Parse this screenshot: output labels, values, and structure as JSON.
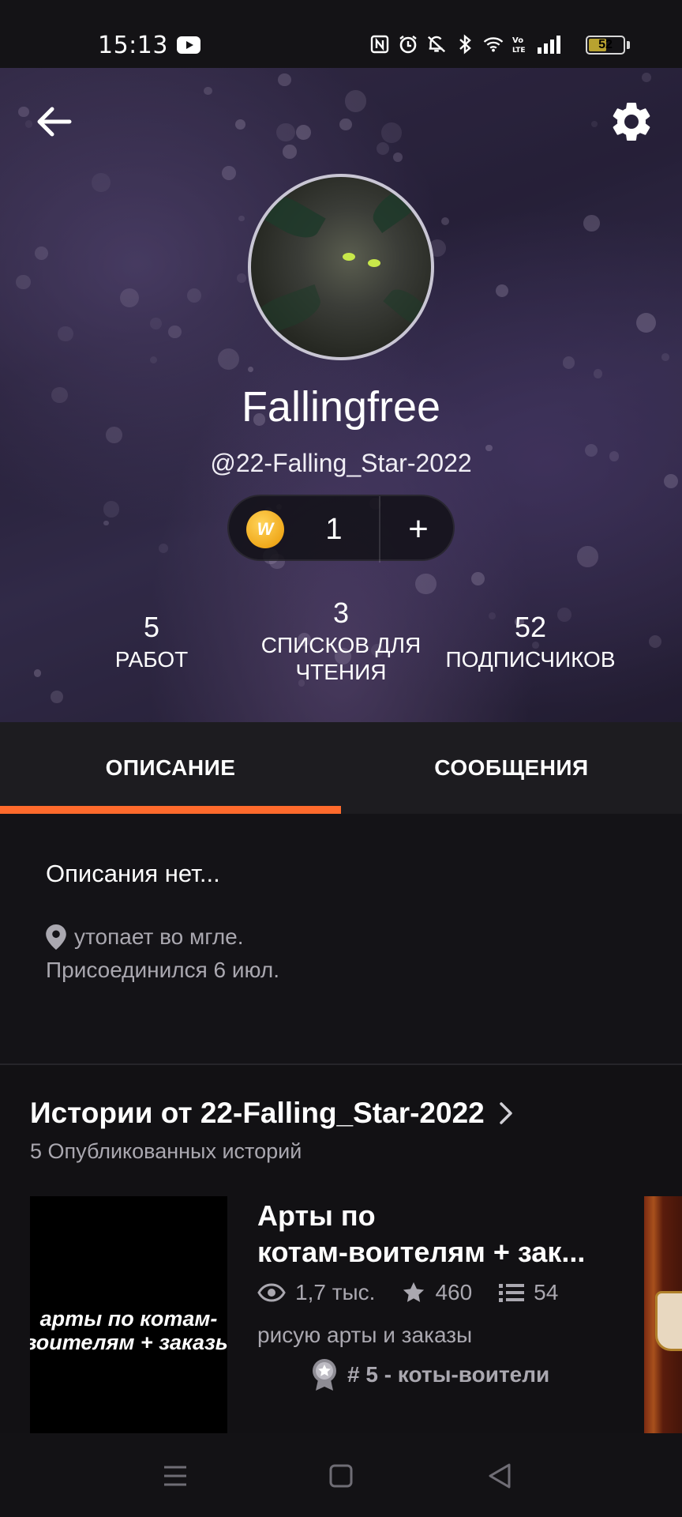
{
  "status_bar": {
    "time": "15:13",
    "battery": "52",
    "battery_level": 0.52,
    "icons": [
      "youtube-icon",
      "nfc-icon",
      "alarm-icon",
      "mute-icon",
      "bluetooth-icon",
      "wifi-icon",
      "volte-icon",
      "signal-icon",
      "battery-icon"
    ]
  },
  "header": {
    "back_icon": "arrow-left-icon",
    "settings_icon": "gear-icon",
    "username": "Fallingfree",
    "handle": "@22-Falling_Star-2022",
    "coins": {
      "count": "1",
      "add_label": "+",
      "coin_symbol": "W"
    },
    "stats": [
      {
        "value": "5",
        "label": "РАБОТ"
      },
      {
        "value": "3",
        "label": "СПИСКОВ ДЛЯ ЧТЕНИЯ"
      },
      {
        "value": "52",
        "label": "ПОДПИСЧИКОВ"
      }
    ]
  },
  "tabs": [
    {
      "label": "ОПИСАНИЕ",
      "active": true
    },
    {
      "label": "СООБЩЕНИЯ",
      "active": false
    }
  ],
  "description": {
    "text": "Описания нет...",
    "location": "утопает во мгле.",
    "joined": "Присоединился 6 июл."
  },
  "stories": {
    "title": "Истории от 22-Falling_Star-2022",
    "subtitle": "5 Опубликованных историй",
    "items": [
      {
        "cover_text": "арты по котам-воителям + заказы",
        "title_line1": "Арты по",
        "title_line2": "котам-воителям + зак...",
        "reads": "1,7 тыс.",
        "votes": "460",
        "parts": "54",
        "description": "рисую арты и заказы",
        "rank": "# 5 - коты-воители"
      }
    ]
  },
  "colors": {
    "accent": "#ff6a2c",
    "background": "#121114",
    "muted_text": "#aaa8b0"
  },
  "navbar": {
    "icons": [
      "menu-icon",
      "home-square-icon",
      "back-triangle-icon"
    ]
  }
}
